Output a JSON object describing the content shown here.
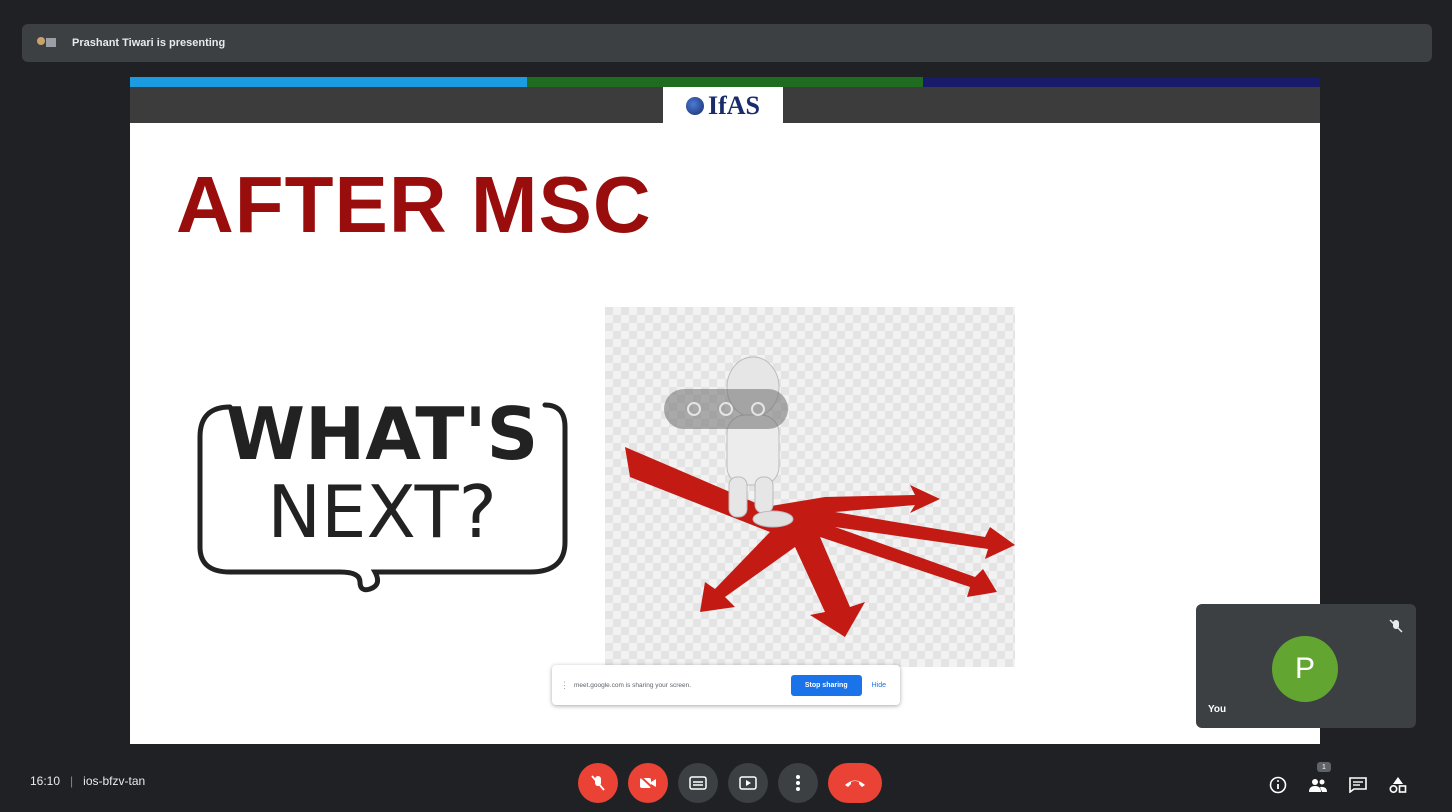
{
  "presenter_bar": {
    "label": "Prashant Tiwari is presenting"
  },
  "slide": {
    "logo_text": "IfAS",
    "title": "AFTER MSC",
    "whats_next_line1": "WHAT'S",
    "whats_next_line2": "NEXT?",
    "strip_colors": [
      "#1b9be0",
      "#1f6b1f",
      "#1a1a6b"
    ],
    "title_color": "#9a0d0d"
  },
  "share_bar": {
    "message": "meet.google.com is sharing your screen.",
    "stop_label": "Stop sharing",
    "hide_label": "Hide"
  },
  "self_tile": {
    "avatar_letter": "P",
    "name": "You",
    "avatar_color": "#62a531"
  },
  "meeting": {
    "time": "16:10",
    "code": "ios-bfzv-tan"
  },
  "controls": {
    "items": [
      "mic-off-icon",
      "camera-off-icon",
      "captions-icon",
      "present-icon",
      "more-options-icon",
      "hangup-icon"
    ]
  },
  "right_icons": {
    "items": [
      "info-icon",
      "people-icon",
      "chat-icon",
      "activities-icon"
    ],
    "people_badge": "1"
  }
}
